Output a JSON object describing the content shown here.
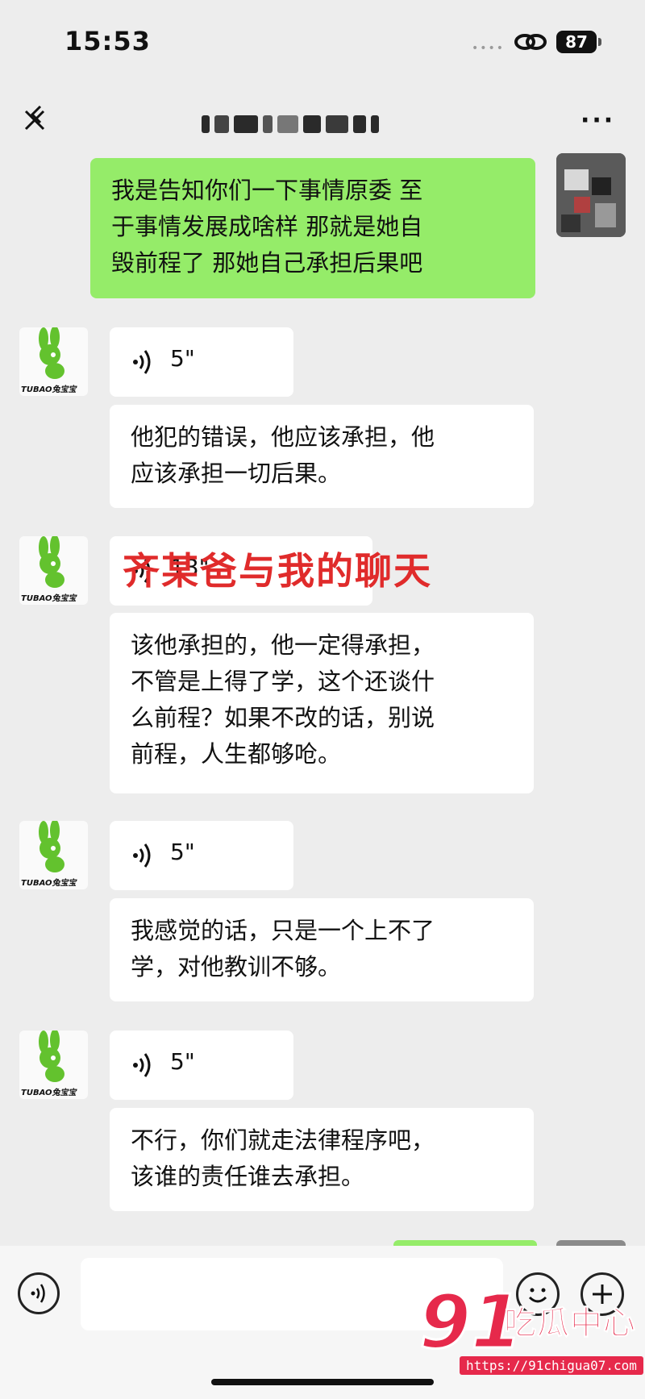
{
  "status_bar": {
    "time": "15:53",
    "battery": "87"
  },
  "nav": {
    "title": ""
  },
  "messages": [
    {
      "id": "m1",
      "side": "right",
      "kind": "text",
      "text": "我是告知你们一下事情原委 至\n于事情发展成啥样 那就是她自\n毁前程了 那她自己承担后果吧"
    },
    {
      "id": "m2",
      "side": "left",
      "kind": "voice",
      "duration": "5\""
    },
    {
      "id": "m3",
      "side": "left",
      "kind": "text",
      "text": "他犯的错误，他应该承担，他\n应该承担一切后果。"
    },
    {
      "id": "m4",
      "side": "left",
      "kind": "voice",
      "duration": "13\""
    },
    {
      "id": "m5",
      "side": "left",
      "kind": "text",
      "text": "该他承担的，他一定得承担，\n不管是上得了学，这个还谈什\n么前程？如果不改的话，别说\n前程，人生都够呛。"
    },
    {
      "id": "m6",
      "side": "left",
      "kind": "voice",
      "duration": "5\""
    },
    {
      "id": "m7",
      "side": "left",
      "kind": "text",
      "text": "我感觉的话，只是一个上不了\n学，对他教训不够。"
    },
    {
      "id": "m8",
      "side": "left",
      "kind": "voice",
      "duration": "5\""
    },
    {
      "id": "m9",
      "side": "left",
      "kind": "text",
      "text": "不行，你们就走法律程序吧，\n该谁的责任谁去承担。"
    }
  ],
  "avatar_brand": "TUBAO兔宝宝",
  "overlay_caption": "齐某爸与我的聊天",
  "input": {
    "placeholder": ""
  },
  "watermark": {
    "number": "91",
    "name": "吃瓜中心",
    "url": "https://91chigua07.com"
  },
  "colors": {
    "sent_bubble": "#95ec69",
    "received_bubble": "#ffffff",
    "background": "#ededed",
    "caption_red": "#e02b2b",
    "watermark_red": "#e6294b"
  }
}
